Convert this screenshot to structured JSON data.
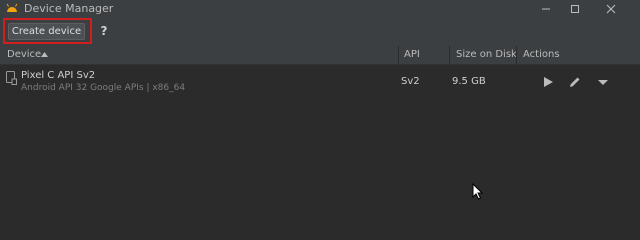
{
  "window": {
    "title": "Device Manager",
    "controls": [
      "minimize-icon",
      "maximize-icon",
      "close-icon"
    ]
  },
  "toolbar": {
    "create_label": "Create device",
    "help_label": "?"
  },
  "table": {
    "columns": [
      "Device",
      "API",
      "Size on Disk",
      "Actions"
    ],
    "sort_column": "Device",
    "sort_direction": "ascending",
    "rows": [
      {
        "name": "Pixel C API Sv2",
        "details": "Android API 32 Google APIs | x86_64",
        "api": "Sv2",
        "size": "9.5 GB",
        "actions": [
          "play-icon",
          "edit-pencil-icon",
          "dropdown-arrow-icon"
        ]
      }
    ]
  },
  "colors": {
    "background": "#2b2b2b",
    "toolbar": "#3c3f41",
    "highlight": "#d11f1f",
    "app_icon": "#f0a30a"
  }
}
